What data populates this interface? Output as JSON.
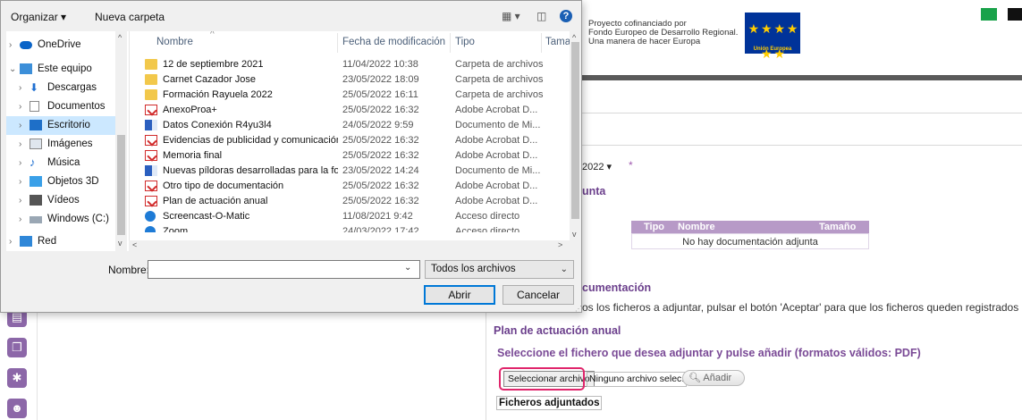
{
  "colors": {
    "accent_purple": "#6b3f8c",
    "highlight": "#e0256b",
    "selection": "#cce8ff",
    "eu_blue": "#003399"
  },
  "dialog": {
    "toolbar": {
      "organize": "Organizar ▾",
      "new_folder": "Nueva carpeta",
      "view_icon": "view-options-icon",
      "pane_icon": "preview-pane-icon",
      "help": "?"
    },
    "nav": [
      {
        "label": "OneDrive",
        "icon": "cloud-icon",
        "chevron": "›"
      },
      {
        "label": "Este equipo",
        "icon": "computer-icon",
        "chevron": "⌄"
      },
      {
        "label": "Descargas",
        "icon": "download-icon",
        "chevron": "›"
      },
      {
        "label": "Documentos",
        "icon": "document-icon",
        "chevron": "›"
      },
      {
        "label": "Escritorio",
        "icon": "desktop-icon",
        "chevron": "›"
      },
      {
        "label": "Imágenes",
        "icon": "image-icon",
        "chevron": "›"
      },
      {
        "label": "Música",
        "icon": "music-icon",
        "chevron": "›"
      },
      {
        "label": "Objetos 3D",
        "icon": "cube-icon",
        "chevron": "›"
      },
      {
        "label": "Vídeos",
        "icon": "video-icon",
        "chevron": "›"
      },
      {
        "label": "Windows (C:)",
        "icon": "drive-icon",
        "chevron": "›"
      },
      {
        "label": "Red",
        "icon": "network-icon",
        "chevron": "›"
      }
    ],
    "columns": {
      "name": "Nombre",
      "date": "Fecha de modificación",
      "type": "Tipo",
      "size": "Tamaŕ"
    },
    "files": [
      {
        "name": "12 de septiembre 2021",
        "date": "11/04/2022 10:38",
        "type": "Carpeta de archivos",
        "icon": "folder"
      },
      {
        "name": "Carnet Cazador Jose",
        "date": "23/05/2022 18:09",
        "type": "Carpeta de archivos",
        "icon": "folder"
      },
      {
        "name": "Formación Rayuela 2022",
        "date": "25/05/2022 16:11",
        "type": "Carpeta de archivos",
        "icon": "folder"
      },
      {
        "name": "AnexoProa+",
        "date": "25/05/2022 16:32",
        "type": "Adobe Acrobat D...",
        "icon": "pdf"
      },
      {
        "name": "Datos Conexión R4yu3l4",
        "date": "24/05/2022 9:59",
        "type": "Documento de Mi...",
        "icon": "doc"
      },
      {
        "name": "Evidencias de publicidad y comunicación",
        "date": "25/05/2022 16:32",
        "type": "Adobe Acrobat D...",
        "icon": "pdf"
      },
      {
        "name": "Memoria final",
        "date": "25/05/2022 16:32",
        "type": "Adobe Acrobat D...",
        "icon": "pdf"
      },
      {
        "name": "Nuevas píldoras desarrolladas para la for...",
        "date": "23/05/2022 14:24",
        "type": "Documento de Mi...",
        "icon": "doc"
      },
      {
        "name": "Otro tipo de documentación",
        "date": "25/05/2022 16:32",
        "type": "Adobe Acrobat D...",
        "icon": "pdf"
      },
      {
        "name": "Plan de actuación anual",
        "date": "25/05/2022 16:32",
        "type": "Adobe Acrobat D...",
        "icon": "pdf"
      },
      {
        "name": "Screencast-O-Matic",
        "date": "11/08/2021 9:42",
        "type": "Acceso directo",
        "icon": "link"
      },
      {
        "name": "Zoom",
        "date": "24/03/2022 17:42",
        "type": "Acceso directo",
        "icon": "link"
      }
    ],
    "filename_label": "Nombre:",
    "filename_value": "",
    "filetype": "Todos los archivos",
    "open_button": "Abrir",
    "cancel_button": "Cancelar"
  },
  "page": {
    "eu_text_1": "Proyecto cofinanciado por",
    "eu_text_2": "Fondo Europeo de Desarrollo Regional.",
    "eu_text_3": "Una manera de hacer Europa",
    "eu_flag_stars": "★ ★ ★ ★ ★ ★",
    "eu_flag_label": "Unión Europea",
    "year_value": "2022 ▾",
    "required_mark": "*",
    "section_fragment_1": "unta",
    "table_headers": {
      "type": "Tipo",
      "name": "Nombre",
      "size": "Tamaño"
    },
    "table_empty": "No hay documentación adjunta",
    "section_fragment_2": "cumentación",
    "instructions": "os los ficheros a adjuntar, pulsar el botón 'Aceptar' para que los ficheros queden registrados",
    "plan_title": "Plan de actuación anual",
    "select_prompt": "Seleccione el fichero que desea adjuntar y pulse añadir (formatos válidos: PDF)",
    "select_file_button": "Seleccionar archivo",
    "no_file_text": "Ninguno archivo selec.",
    "add_button": "Añadir",
    "attached_files": "Ficheros adjuntados"
  }
}
